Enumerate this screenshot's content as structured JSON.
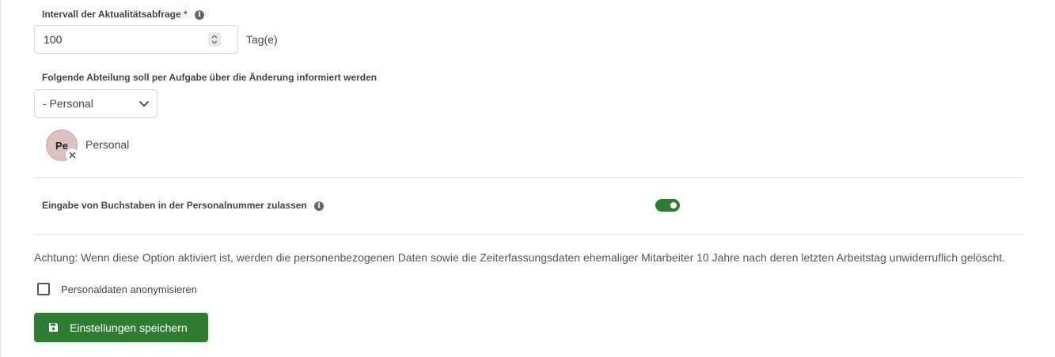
{
  "interval": {
    "label": "Intervall der Aktualitätsabfrage",
    "required_mark": "*",
    "value": "100",
    "unit": "Tag(e)"
  },
  "department": {
    "label": "Folgende Abteilung soll per Aufgabe über die Änderung informiert werden",
    "selected": "- Personal",
    "chip": {
      "initials": "Pe",
      "name": "Personal"
    }
  },
  "letters_setting": {
    "label": "Eingabe von Buchstaben in der Personalnummer zulassen",
    "enabled": true
  },
  "anonymize": {
    "warning": "Achtung: Wenn diese Option aktiviert ist, werden die personenbezogenen Daten sowie die Zeiterfassungsdaten ehemaliger Mitarbeiter 10 Jahre nach deren letzten Arbeitstag unwiderruflich gelöscht.",
    "checkbox_label": "Personaldaten anonymisieren",
    "checked": false
  },
  "save_button": {
    "label": "Einstellungen speichern",
    "icon": "save-icon"
  },
  "colors": {
    "accent": "#2e7d32",
    "required": "#d32f2f",
    "avatar_bg": "#dcc1c1"
  }
}
